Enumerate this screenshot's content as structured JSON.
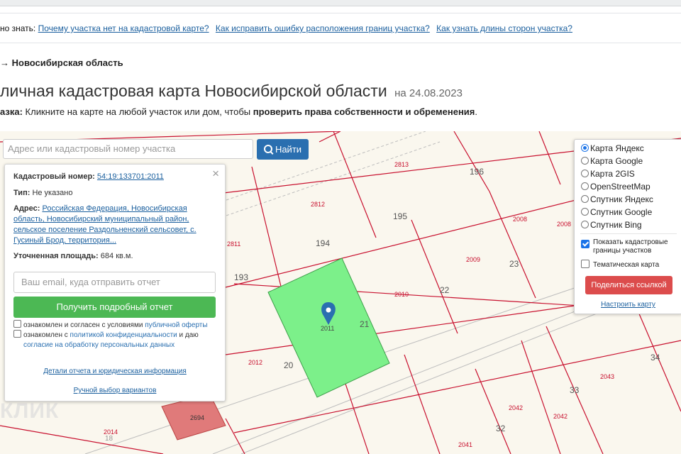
{
  "header": {
    "faq_label": "но знать:",
    "faq_links": [
      "Почему участка нет на кадастровой карте?",
      "Как исправить ошибку расположения границ участка?",
      "Как узнать длины сторон участка?"
    ],
    "breadcrumb": "→ Новосибирская область",
    "title": "личная кадастровая карта Новосибирской области",
    "date": "на 24.08.2023",
    "hint_prefix": "азка:",
    "hint_text": "Кликните на карте на любой участок или дом, чтобы",
    "hint_bold": "проверить права собственности и обременения",
    "hint_end": "."
  },
  "search": {
    "placeholder": "Адрес или кадастровый номер участка",
    "button_label": "Найти"
  },
  "popup": {
    "close": "×",
    "cad_label": "Кадастровый номер:",
    "cad_value": "54:19:133701:2011",
    "type_label": "Тип:",
    "type_value": "Не указано",
    "addr_label": "Адрес:",
    "addr_value": "Российская Федерация, Новосибирская область, Новосибирский муниципальный район, сельское поселение Раздольненский сельсовет, с. Гусиный Брод, территория...",
    "area_label": "Уточненная площадь:",
    "area_value": "684 кв.м.",
    "email_placeholder": "Ваш email, куда отправить отчет",
    "report_button": "Получить подробный отчет",
    "consent1_text": "ознакомлен и согласен с условиями",
    "consent1_link": "публичной оферты",
    "consent2_text": "ознакомлен с",
    "consent2_link": "политикой конфиденциальности",
    "consent2_mid": "и даю",
    "consent2_link2": "согласие на обработку персональных данных",
    "details_link": "Детали отчета и юридическая информация",
    "manual_link": "Ручной выбор вариантов"
  },
  "layers": {
    "options": [
      {
        "label": "Карта Яндекс",
        "selected": true
      },
      {
        "label": "Карта Google",
        "selected": false
      },
      {
        "label": "Карта 2GIS",
        "selected": false
      },
      {
        "label": "OpenStreetMap",
        "selected": false
      },
      {
        "label": "Спутник Яндекс",
        "selected": false
      },
      {
        "label": "Спутник Google",
        "selected": false
      },
      {
        "label": "Спутник Bing",
        "selected": false
      }
    ],
    "show_borders": "Показать кадастровые границы участков",
    "show_borders_checked": true,
    "thematic": "Тематическая карта",
    "thematic_checked": false,
    "share_button": "Поделиться ссылкой",
    "setup_link": "Настроить карту"
  },
  "map": {
    "parcel_labels": [
      "2813",
      "196",
      "2812",
      "195",
      "2008",
      "2008",
      "2811",
      "194",
      "2009",
      "23",
      "193",
      "2010",
      "22",
      "2011",
      "21",
      "2012",
      "20",
      "34",
      "2043",
      "33",
      "2694",
      "2042",
      "2042",
      "32",
      "2014",
      "18",
      "2041"
    ],
    "watermark": "КЛИК",
    "colors": {
      "selected_parcel": "#7cf08a",
      "highlight_parcel": "#e07a7a",
      "border": "#c8102e",
      "background": "#faf7ee"
    }
  }
}
